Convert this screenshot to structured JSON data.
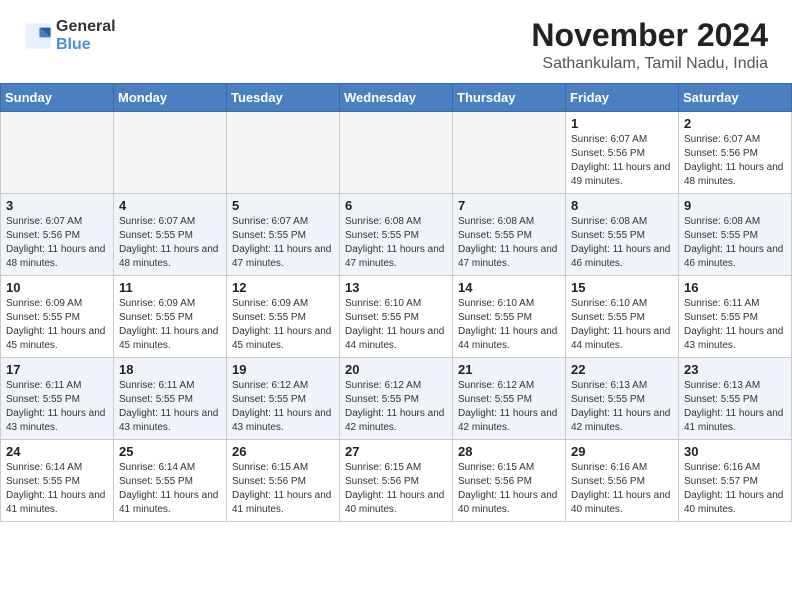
{
  "header": {
    "logo_general": "General",
    "logo_blue": "Blue",
    "month_title": "November 2024",
    "location": "Sathankulam, Tamil Nadu, India"
  },
  "calendar": {
    "weekdays": [
      "Sunday",
      "Monday",
      "Tuesday",
      "Wednesday",
      "Thursday",
      "Friday",
      "Saturday"
    ],
    "weeks": [
      [
        {
          "day": "",
          "info": ""
        },
        {
          "day": "",
          "info": ""
        },
        {
          "day": "",
          "info": ""
        },
        {
          "day": "",
          "info": ""
        },
        {
          "day": "",
          "info": ""
        },
        {
          "day": "1",
          "info": "Sunrise: 6:07 AM\nSunset: 5:56 PM\nDaylight: 11 hours and 49 minutes."
        },
        {
          "day": "2",
          "info": "Sunrise: 6:07 AM\nSunset: 5:56 PM\nDaylight: 11 hours and 48 minutes."
        }
      ],
      [
        {
          "day": "3",
          "info": "Sunrise: 6:07 AM\nSunset: 5:56 PM\nDaylight: 11 hours and 48 minutes."
        },
        {
          "day": "4",
          "info": "Sunrise: 6:07 AM\nSunset: 5:55 PM\nDaylight: 11 hours and 48 minutes."
        },
        {
          "day": "5",
          "info": "Sunrise: 6:07 AM\nSunset: 5:55 PM\nDaylight: 11 hours and 47 minutes."
        },
        {
          "day": "6",
          "info": "Sunrise: 6:08 AM\nSunset: 5:55 PM\nDaylight: 11 hours and 47 minutes."
        },
        {
          "day": "7",
          "info": "Sunrise: 6:08 AM\nSunset: 5:55 PM\nDaylight: 11 hours and 47 minutes."
        },
        {
          "day": "8",
          "info": "Sunrise: 6:08 AM\nSunset: 5:55 PM\nDaylight: 11 hours and 46 minutes."
        },
        {
          "day": "9",
          "info": "Sunrise: 6:08 AM\nSunset: 5:55 PM\nDaylight: 11 hours and 46 minutes."
        }
      ],
      [
        {
          "day": "10",
          "info": "Sunrise: 6:09 AM\nSunset: 5:55 PM\nDaylight: 11 hours and 45 minutes."
        },
        {
          "day": "11",
          "info": "Sunrise: 6:09 AM\nSunset: 5:55 PM\nDaylight: 11 hours and 45 minutes."
        },
        {
          "day": "12",
          "info": "Sunrise: 6:09 AM\nSunset: 5:55 PM\nDaylight: 11 hours and 45 minutes."
        },
        {
          "day": "13",
          "info": "Sunrise: 6:10 AM\nSunset: 5:55 PM\nDaylight: 11 hours and 44 minutes."
        },
        {
          "day": "14",
          "info": "Sunrise: 6:10 AM\nSunset: 5:55 PM\nDaylight: 11 hours and 44 minutes."
        },
        {
          "day": "15",
          "info": "Sunrise: 6:10 AM\nSunset: 5:55 PM\nDaylight: 11 hours and 44 minutes."
        },
        {
          "day": "16",
          "info": "Sunrise: 6:11 AM\nSunset: 5:55 PM\nDaylight: 11 hours and 43 minutes."
        }
      ],
      [
        {
          "day": "17",
          "info": "Sunrise: 6:11 AM\nSunset: 5:55 PM\nDaylight: 11 hours and 43 minutes."
        },
        {
          "day": "18",
          "info": "Sunrise: 6:11 AM\nSunset: 5:55 PM\nDaylight: 11 hours and 43 minutes."
        },
        {
          "day": "19",
          "info": "Sunrise: 6:12 AM\nSunset: 5:55 PM\nDaylight: 11 hours and 43 minutes."
        },
        {
          "day": "20",
          "info": "Sunrise: 6:12 AM\nSunset: 5:55 PM\nDaylight: 11 hours and 42 minutes."
        },
        {
          "day": "21",
          "info": "Sunrise: 6:12 AM\nSunset: 5:55 PM\nDaylight: 11 hours and 42 minutes."
        },
        {
          "day": "22",
          "info": "Sunrise: 6:13 AM\nSunset: 5:55 PM\nDaylight: 11 hours and 42 minutes."
        },
        {
          "day": "23",
          "info": "Sunrise: 6:13 AM\nSunset: 5:55 PM\nDaylight: 11 hours and 41 minutes."
        }
      ],
      [
        {
          "day": "24",
          "info": "Sunrise: 6:14 AM\nSunset: 5:55 PM\nDaylight: 11 hours and 41 minutes."
        },
        {
          "day": "25",
          "info": "Sunrise: 6:14 AM\nSunset: 5:55 PM\nDaylight: 11 hours and 41 minutes."
        },
        {
          "day": "26",
          "info": "Sunrise: 6:15 AM\nSunset: 5:56 PM\nDaylight: 11 hours and 41 minutes."
        },
        {
          "day": "27",
          "info": "Sunrise: 6:15 AM\nSunset: 5:56 PM\nDaylight: 11 hours and 40 minutes."
        },
        {
          "day": "28",
          "info": "Sunrise: 6:15 AM\nSunset: 5:56 PM\nDaylight: 11 hours and 40 minutes."
        },
        {
          "day": "29",
          "info": "Sunrise: 6:16 AM\nSunset: 5:56 PM\nDaylight: 11 hours and 40 minutes."
        },
        {
          "day": "30",
          "info": "Sunrise: 6:16 AM\nSunset: 5:57 PM\nDaylight: 11 hours and 40 minutes."
        }
      ]
    ]
  }
}
